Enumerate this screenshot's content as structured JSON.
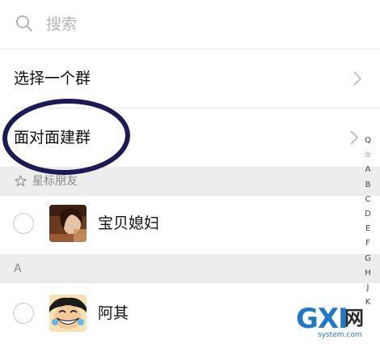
{
  "search": {
    "placeholder": "搜索",
    "icon": "search-icon"
  },
  "menu": [
    {
      "label": "选择一个群",
      "icon": "chevron-right-icon"
    },
    {
      "label": "面对面建群",
      "icon": "chevron-right-icon"
    }
  ],
  "sections": [
    {
      "header": "星标朋友",
      "header_icon": "star-icon",
      "contacts": [
        {
          "name": "宝贝媳妇",
          "avatar": "avatar-photo"
        }
      ]
    },
    {
      "header": "A",
      "contacts": [
        {
          "name": "阿其",
          "avatar": "avatar-cartoon"
        }
      ]
    }
  ],
  "index_bar": [
    "Q",
    "☆",
    "A",
    "B",
    "C",
    "D",
    "E",
    "F",
    "G",
    "H",
    "J",
    "K"
  ],
  "watermark": {
    "main": "GXI",
    "cn": "网",
    "sub": "system.com"
  },
  "colors": {
    "annotation": "#1c1a55",
    "section_bg": "#ededed",
    "watermark_blue": "#1f79c9"
  }
}
